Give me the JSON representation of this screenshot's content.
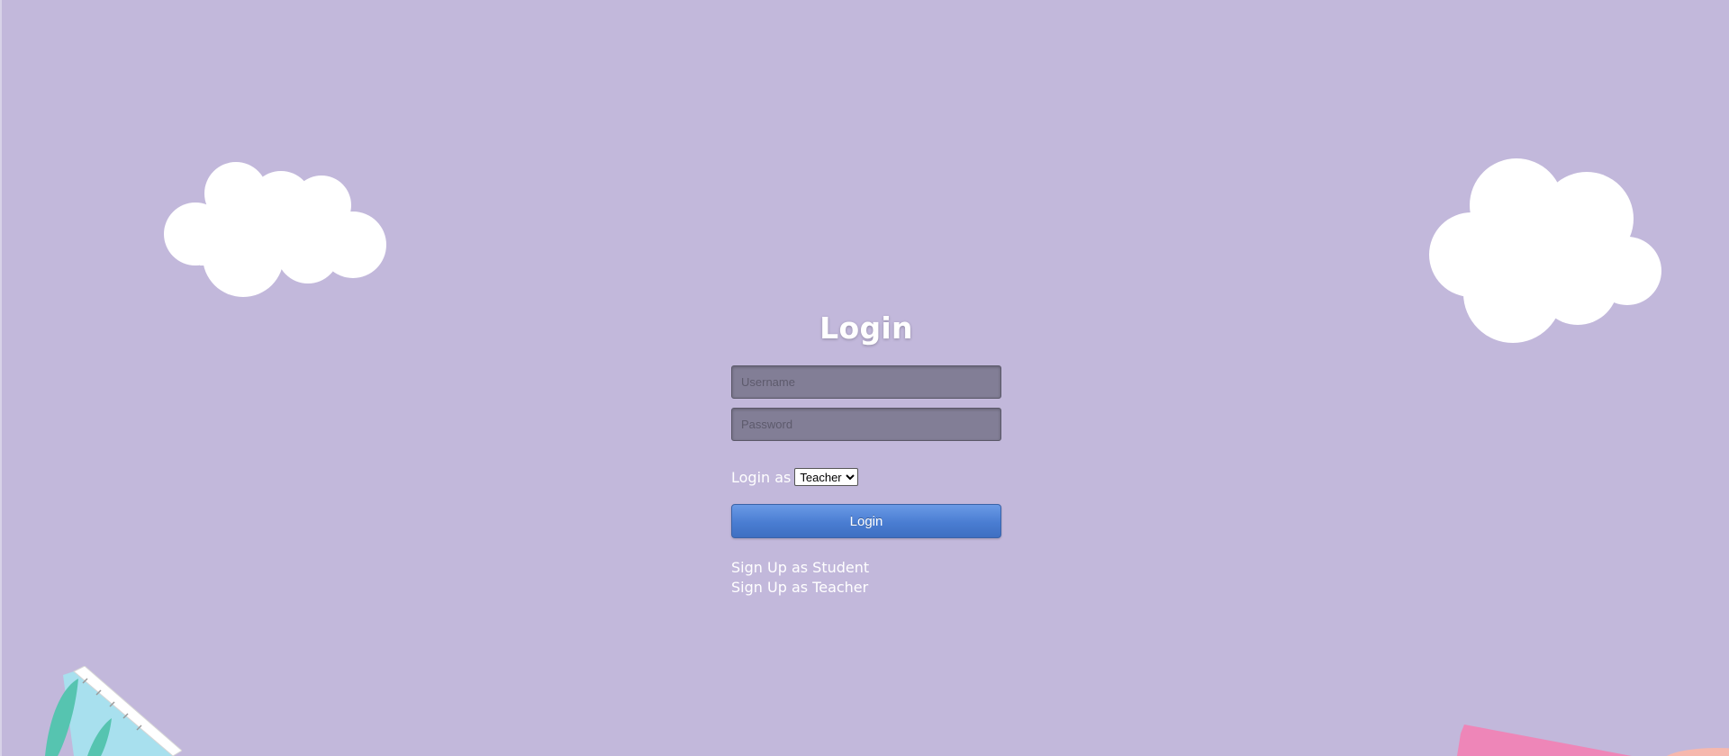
{
  "page": {
    "title": "Login",
    "background_color": "#c2b8db"
  },
  "form": {
    "username_placeholder": "Username",
    "password_placeholder": "Password",
    "role_label": "Login as",
    "role_options": [
      "Teacher"
    ],
    "role_selected": "Teacher",
    "submit_label": "Login"
  },
  "links": {
    "signup_student": "Sign Up as Student",
    "signup_teacher": "Sign Up as Teacher"
  },
  "colors": {
    "accent_button": "#4a7dd2",
    "field_background": "#827e96",
    "text": "#ffffff"
  },
  "icons": [
    "cloud-icon",
    "cloud-icon",
    "ruler-decoration",
    "pink-book-decoration"
  ]
}
